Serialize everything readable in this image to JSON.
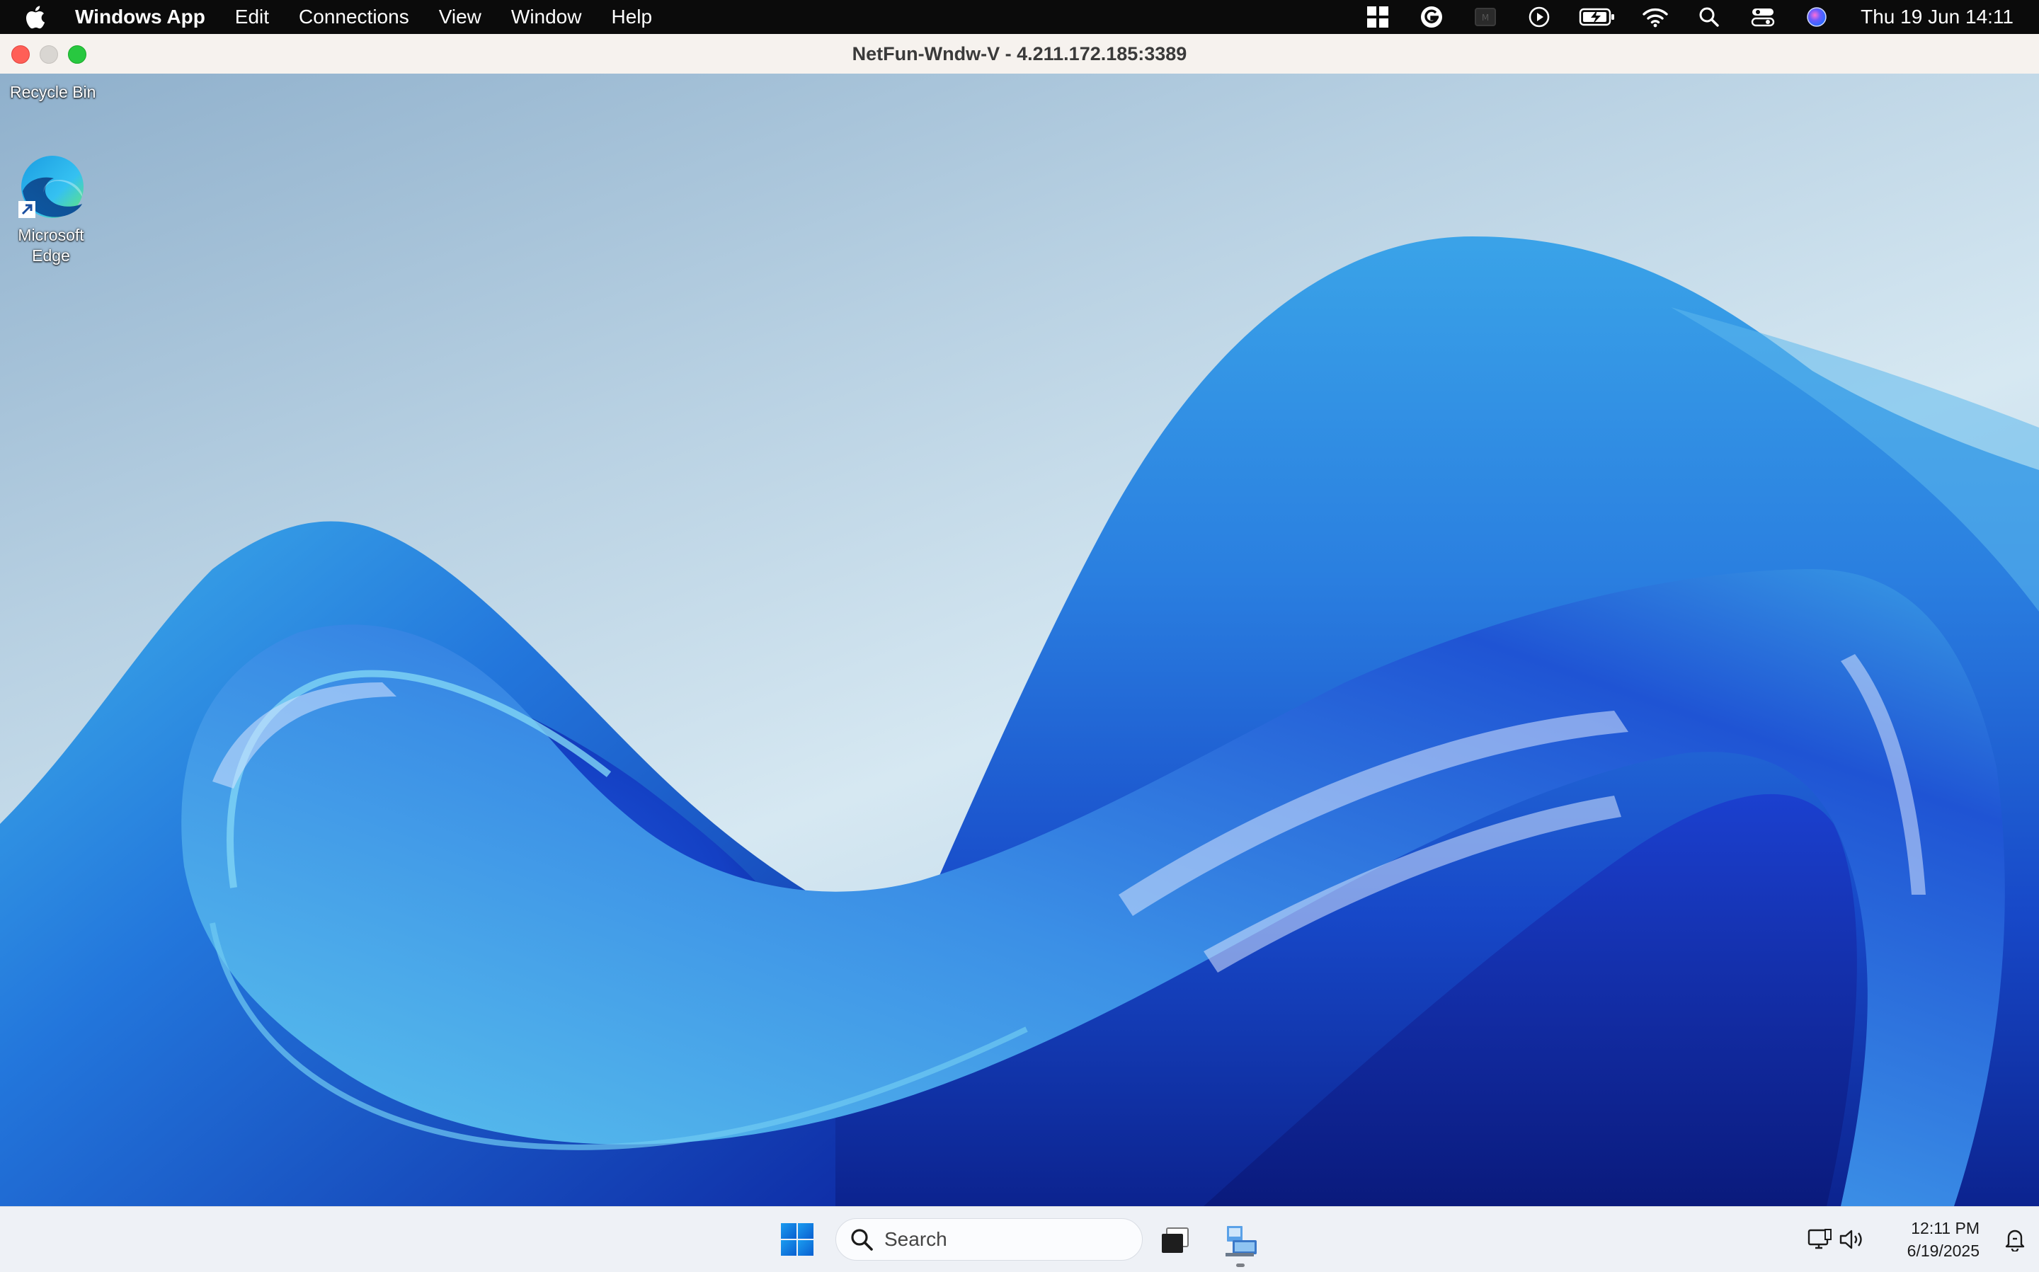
{
  "menubar": {
    "app_name": "Windows App",
    "items": [
      "Edit",
      "Connections",
      "View",
      "Window",
      "Help"
    ],
    "status_icons": [
      "windows-grid-icon",
      "grammarly-icon",
      "screen-record-icon",
      "play-icon",
      "battery-charging-icon",
      "wifi-icon",
      "spotlight-search-icon",
      "control-center-icon",
      "siri-icon"
    ],
    "clock": "Thu 19 Jun  14:11"
  },
  "window": {
    "title": "NetFun-Wndw-V - 4.211.172.185:3389"
  },
  "desktop": {
    "icons": [
      {
        "label": "Recycle Bin"
      },
      {
        "label": "Microsoft Edge"
      }
    ]
  },
  "taskbar": {
    "search_placeholder": "Search",
    "time": "12:11 PM",
    "date": "6/19/2025"
  },
  "colors": {
    "menubar_bg": "#0b0b0b",
    "titlebar_bg": "#f6f2ee",
    "taskbar_bg": "#eef1f6",
    "close": "#ff5f57",
    "maximize": "#28c840",
    "windows_blue": "#1a73e8"
  }
}
